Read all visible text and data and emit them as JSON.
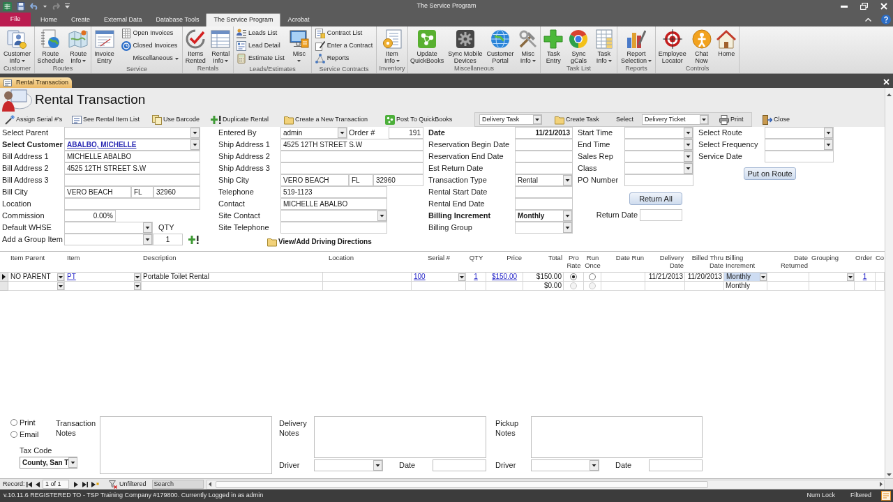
{
  "window": {
    "title": "The Service Program"
  },
  "ribbon_tabs": [
    {
      "label": "File",
      "kind": "file",
      "selected": false
    },
    {
      "label": "Home",
      "kind": "tab",
      "selected": false
    },
    {
      "label": "Create",
      "kind": "tab",
      "selected": false
    },
    {
      "label": "External Data",
      "kind": "tab",
      "selected": false
    },
    {
      "label": "Database Tools",
      "kind": "tab",
      "selected": false
    },
    {
      "label": "The Service Program",
      "kind": "tab",
      "selected": true
    },
    {
      "label": "Acrobat",
      "kind": "tab",
      "selected": false
    }
  ],
  "ribbon_groups": [
    {
      "label": "Customer",
      "items": [
        {
          "kind": "large",
          "label": [
            "Customer",
            "Info"
          ],
          "dropdown": true
        }
      ]
    },
    {
      "label": "Routes",
      "items": [
        {
          "kind": "large",
          "label": [
            "Route",
            "Schedule"
          ],
          "dropdown": false
        },
        {
          "kind": "large",
          "label": [
            "Route",
            "Info"
          ],
          "dropdown": true
        }
      ]
    },
    {
      "label": "Service",
      "items": [
        {
          "kind": "large",
          "label": [
            "Invoice",
            "Entry"
          ],
          "dropdown": false
        },
        {
          "kind": "small",
          "label": "Open Invoices",
          "dropdown": false
        },
        {
          "kind": "small",
          "label": "Closed Invoices",
          "dropdown": false
        },
        {
          "kind": "small",
          "label": "Miscellaneous",
          "dropdown": true
        }
      ]
    },
    {
      "label": "Rentals",
      "items": [
        {
          "kind": "large",
          "label": [
            "Items",
            "Rented"
          ],
          "dropdown": false
        },
        {
          "kind": "large",
          "label": [
            "Rental",
            "Info"
          ],
          "dropdown": true
        }
      ]
    },
    {
      "label": "Leads/Estimates",
      "items": [
        {
          "kind": "small",
          "label": "Leads List",
          "dropdown": false
        },
        {
          "kind": "small",
          "label": "Lead Detail",
          "dropdown": false
        },
        {
          "kind": "small",
          "label": "Estimate List",
          "dropdown": false
        },
        {
          "kind": "large",
          "label": [
            "Misc"
          ],
          "dropdown": true
        }
      ]
    },
    {
      "label": "Service Contracts",
      "items": [
        {
          "kind": "small",
          "label": "Contract List",
          "dropdown": false
        },
        {
          "kind": "small",
          "label": "Enter a Contract",
          "dropdown": false
        },
        {
          "kind": "small",
          "label": "Reports",
          "dropdown": false
        }
      ]
    },
    {
      "label": "Inventory",
      "items": [
        {
          "kind": "large",
          "label": [
            "Item",
            "Info"
          ],
          "dropdown": true
        }
      ]
    },
    {
      "label": "Miscellaneous",
      "items": [
        {
          "kind": "large",
          "label": [
            "Update",
            "QuickBooks"
          ],
          "dropdown": false
        },
        {
          "kind": "large",
          "label": [
            "Sync Mobile",
            "Devices"
          ],
          "dropdown": false
        },
        {
          "kind": "large",
          "label": [
            "Customer",
            "Portal"
          ],
          "dropdown": false
        },
        {
          "kind": "large",
          "label": [
            "Misc",
            "Info"
          ],
          "dropdown": true
        }
      ]
    },
    {
      "label": "Task List",
      "items": [
        {
          "kind": "large",
          "label": [
            "Task",
            "Entry"
          ],
          "dropdown": false
        },
        {
          "kind": "large",
          "label": [
            "Sync",
            "gCals"
          ],
          "dropdown": false
        },
        {
          "kind": "large",
          "label": [
            "Task",
            "Info"
          ],
          "dropdown": true
        }
      ]
    },
    {
      "label": "Reports",
      "items": [
        {
          "kind": "large",
          "label": [
            "Report",
            "Selection"
          ],
          "dropdown": true
        }
      ]
    },
    {
      "label": "Controls",
      "items": [
        {
          "kind": "large",
          "label": [
            "Employee",
            "Locator"
          ],
          "dropdown": false
        },
        {
          "kind": "large",
          "label": [
            "Chat",
            "Now"
          ],
          "dropdown": false
        },
        {
          "kind": "large",
          "label": [
            "Home"
          ],
          "dropdown": false
        }
      ]
    }
  ],
  "document_tabs": [
    {
      "label": "Rental Transaction",
      "selected": true
    }
  ],
  "form": {
    "title": "Rental Transaction",
    "toolbar": [
      {
        "label": "Assign Serial #'s"
      },
      {
        "label": "See Rental Item List"
      },
      {
        "label": "Use Barcode"
      },
      {
        "label": "Duplicate Rental"
      },
      {
        "label": "Create a New Transaction"
      },
      {
        "label": "Post To QuickBooks"
      }
    ],
    "task_box": [
      {
        "kind": "combo",
        "value": "Delivery Task"
      },
      {
        "kind": "link",
        "label": "Create Task"
      },
      {
        "kind": "caption",
        "label": "Select"
      },
      {
        "kind": "combo",
        "value": "Delivery Ticket"
      },
      {
        "kind": "link",
        "label": "Print"
      }
    ],
    "close_link": {
      "label": "Close"
    },
    "columns": [
      {
        "rows": [
          {
            "kind": "field",
            "label": "Select Parent",
            "emphasized": false,
            "fields": [
              {
                "kind": "combo"
              }
            ]
          },
          {
            "kind": "field",
            "label": "Select Customer",
            "emphasized": true,
            "fields": [
              {
                "kind": "link-combo",
                "value": "ABALBO, MICHELLE"
              }
            ]
          },
          {
            "kind": "field",
            "label": "Bill Address 1",
            "emphasized": false,
            "fields": [
              {
                "kind": "text",
                "value": "MICHELLE ABALBO"
              }
            ]
          },
          {
            "kind": "field",
            "label": "Bill Address 2",
            "emphasized": false,
            "fields": [
              {
                "kind": "text",
                "value": "4525 12TH STREET S.W"
              }
            ]
          },
          {
            "kind": "field",
            "label": "Bill Address 3",
            "emphasized": false,
            "fields": [
              {
                "kind": "text"
              }
            ]
          },
          {
            "kind": "field",
            "label": "Bill City",
            "emphasized": false,
            "fields": [
              {
                "kind": "text",
                "value": "VERO BEACH"
              },
              {
                "kind": "text",
                "value": "FL"
              },
              {
                "kind": "text",
                "value": "32960"
              }
            ]
          },
          {
            "kind": "field",
            "label": "Location",
            "emphasized": false,
            "fields": [
              {
                "kind": "text"
              }
            ]
          },
          {
            "kind": "field",
            "label": "Commission",
            "emphasized": false,
            "fields": [
              {
                "kind": "number",
                "value": "0.00%"
              }
            ]
          },
          {
            "kind": "field",
            "label": "Default WHSE",
            "emphasized": false,
            "fields": [
              {
                "kind": "combo"
              },
              {
                "kind": "caption",
                "label": "QTY"
              }
            ]
          },
          {
            "kind": "field",
            "label": "Add a Group Item",
            "emphasized": false,
            "fields": [
              {
                "kind": "combo"
              },
              {
                "kind": "qty",
                "value": "1"
              },
              {
                "kind": "add-button"
              }
            ]
          }
        ]
      },
      {
        "rows": [
          {
            "kind": "field",
            "label": "Entered By",
            "emphasized": false,
            "fields": [
              {
                "kind": "combo",
                "value": "admin"
              },
              {
                "kind": "caption",
                "label": "Order #"
              },
              {
                "kind": "number",
                "value": "191"
              }
            ]
          },
          {
            "kind": "field",
            "label": "Ship Address 1",
            "emphasized": false,
            "fields": [
              {
                "kind": "text",
                "value": "4525 12TH STREET S.W"
              }
            ]
          },
          {
            "kind": "field",
            "label": "Ship Address 2",
            "emphasized": false,
            "fields": [
              {
                "kind": "text"
              }
            ]
          },
          {
            "kind": "field",
            "label": "Ship Address 3",
            "emphasized": false,
            "fields": [
              {
                "kind": "text"
              }
            ]
          },
          {
            "kind": "field",
            "label": "Ship City",
            "emphasized": false,
            "fields": [
              {
                "kind": "text",
                "value": "VERO BEACH"
              },
              {
                "kind": "text",
                "value": "FL"
              },
              {
                "kind": "text",
                "value": "32960"
              }
            ]
          },
          {
            "kind": "field",
            "label": "Telephone",
            "emphasized": false,
            "fields": [
              {
                "kind": "text",
                "value": "519-1123"
              }
            ]
          },
          {
            "kind": "field",
            "label": "Contact",
            "emphasized": false,
            "fields": [
              {
                "kind": "text",
                "value": "MICHELLE ABALBO"
              }
            ]
          },
          {
            "kind": "field",
            "label": "Site Contact",
            "emphasized": false,
            "fields": [
              {
                "kind": "combo"
              }
            ]
          },
          {
            "kind": "field",
            "label": "Site Telephone",
            "emphasized": false,
            "fields": [
              {
                "kind": "text"
              }
            ]
          },
          {
            "kind": "link",
            "label": "View/Add Driving Directions"
          }
        ]
      },
      {
        "rows": [
          {
            "kind": "field",
            "label": "Date",
            "emphasized": true,
            "fields": [
              {
                "kind": "date",
                "value": "11/21/2013"
              }
            ]
          },
          {
            "kind": "field",
            "label": "Reservation Begin Date",
            "emphasized": false,
            "fields": [
              {
                "kind": "date"
              }
            ]
          },
          {
            "kind": "field",
            "label": "Reservation End Date",
            "emphasized": false,
            "fields": [
              {
                "kind": "date"
              }
            ]
          },
          {
            "kind": "field",
            "label": "Est Return Date",
            "emphasized": false,
            "fields": [
              {
                "kind": "date"
              }
            ]
          },
          {
            "kind": "field",
            "label": "Transaction Type",
            "emphasized": false,
            "fields": [
              {
                "kind": "combo",
                "value": "Rental"
              }
            ]
          },
          {
            "kind": "field",
            "label": "Rental Start Date",
            "emphasized": false,
            "fields": [
              {
                "kind": "date"
              }
            ]
          },
          {
            "kind": "field",
            "label": "Rental End Date",
            "emphasized": false,
            "fields": [
              {
                "kind": "date"
              }
            ]
          },
          {
            "kind": "field",
            "label": "Billing Increment",
            "emphasized": true,
            "fields": [
              {
                "kind": "combo",
                "value": "Monthly"
              }
            ]
          },
          {
            "kind": "field",
            "label": "Billing Group",
            "emphasized": false,
            "fields": [
              {
                "kind": "combo"
              }
            ]
          }
        ]
      },
      {
        "rows": [
          {
            "kind": "field",
            "label": "Start Time",
            "emphasized": false,
            "fields": [
              {
                "kind": "combo"
              }
            ]
          },
          {
            "kind": "field",
            "label": "End Time",
            "emphasized": false,
            "fields": [
              {
                "kind": "combo"
              }
            ]
          },
          {
            "kind": "field",
            "label": "Sales Rep",
            "emphasized": false,
            "fields": [
              {
                "kind": "combo"
              }
            ]
          },
          {
            "kind": "field",
            "label": "Class",
            "emphasized": false,
            "fields": [
              {
                "kind": "combo"
              }
            ]
          },
          {
            "kind": "field",
            "label": "PO Number",
            "emphasized": false,
            "fields": [
              {
                "kind": "text"
              }
            ]
          },
          {
            "kind": "button",
            "label": "Return All"
          },
          {
            "kind": "field",
            "label": "Return Date",
            "emphasized": false,
            "fields": [
              {
                "kind": "date"
              }
            ]
          }
        ]
      },
      {
        "rows": [
          {
            "kind": "field",
            "label": "Select Route",
            "emphasized": false,
            "fields": [
              {
                "kind": "combo"
              }
            ]
          },
          {
            "kind": "field",
            "label": "Select Frequency",
            "emphasized": false,
            "fields": [
              {
                "kind": "combo"
              }
            ]
          },
          {
            "kind": "field",
            "label": "Service Date",
            "emphasized": false,
            "fields": [
              {
                "kind": "date"
              }
            ]
          },
          {
            "kind": "button",
            "label": "Put on Route"
          }
        ]
      }
    ]
  },
  "datasheet": {
    "columns": [
      {
        "label": "Item Parent"
      },
      {
        "label": "Item"
      },
      {
        "label": "Description"
      },
      {
        "label": "Location"
      },
      {
        "label": "Serial #"
      },
      {
        "label": "QTY"
      },
      {
        "label": "Price"
      },
      {
        "label": "Total"
      },
      {
        "label": "Pro Rate"
      },
      {
        "label": "Run Once"
      },
      {
        "label": "Date Run"
      },
      {
        "label": "Delivery Date"
      },
      {
        "label": "Billed Thru Date"
      },
      {
        "label": "Billing Increment"
      },
      {
        "label": "Date Returned"
      },
      {
        "label": "Grouping"
      },
      {
        "label": "Order"
      },
      {
        "label": "Co"
      }
    ],
    "rows": [
      {
        "current": true,
        "cells": [
          {
            "kind": "combo",
            "value": "NO PARENT",
            "focused": false
          },
          {
            "kind": "link-combo",
            "value": "PT",
            "focused": false
          },
          {
            "kind": "text",
            "value": "Portable Toilet Rental",
            "focused": false
          },
          {
            "kind": "text",
            "focused": false
          },
          {
            "kind": "link-combo",
            "value": "100",
            "focused": false
          },
          {
            "kind": "link",
            "value": "1",
            "focused": false
          },
          {
            "kind": "link",
            "value": "$150.00",
            "focused": false
          },
          {
            "kind": "money",
            "value": "$150.00",
            "focused": false
          },
          {
            "kind": "radio",
            "checked": true,
            "disabled": false,
            "focused": false
          },
          {
            "kind": "radio",
            "checked": false,
            "disabled": false,
            "focused": false
          },
          {
            "kind": "text",
            "focused": false
          },
          {
            "kind": "date",
            "value": "11/21/2013",
            "focused": false
          },
          {
            "kind": "date",
            "value": "11/20/2013",
            "focused": false
          },
          {
            "kind": "combo",
            "value": "Monthly",
            "focused": true
          },
          {
            "kind": "text",
            "focused": false
          },
          {
            "kind": "combo",
            "focused": false
          },
          {
            "kind": "link",
            "value": "1",
            "focused": false
          },
          {
            "kind": "text",
            "focused": false
          }
        ]
      },
      {
        "current": false,
        "cells": [
          {
            "kind": "combo",
            "focused": false
          },
          {
            "kind": "combo",
            "focused": false
          },
          {
            "kind": "text",
            "focused": false
          },
          {
            "kind": "text",
            "focused": false
          },
          {
            "kind": "text",
            "focused": false
          },
          {
            "kind": "text",
            "focused": false
          },
          {
            "kind": "text",
            "focused": false
          },
          {
            "kind": "money",
            "value": "$0.00",
            "focused": false
          },
          {
            "kind": "radio",
            "checked": false,
            "disabled": true,
            "focused": false
          },
          {
            "kind": "radio",
            "checked": false,
            "disabled": true,
            "focused": false
          },
          {
            "kind": "text",
            "focused": false
          },
          {
            "kind": "date",
            "focused": false
          },
          {
            "kind": "date",
            "focused": false
          },
          {
            "kind": "text",
            "value": "Monthly",
            "focused": false
          },
          {
            "kind": "text",
            "focused": false
          },
          {
            "kind": "text",
            "focused": false
          },
          {
            "kind": "text",
            "focused": false
          },
          {
            "kind": "text",
            "focused": false
          }
        ]
      }
    ]
  },
  "notes_section": {
    "output_options": [
      {
        "label": "Print",
        "selected": false
      },
      {
        "label": "Email",
        "selected": false
      }
    ],
    "transaction_notes": {
      "label": "Transaction Notes"
    },
    "tax_code": {
      "label": "Tax Code",
      "value": "County, San T"
    },
    "dispatch_notes": [
      {
        "label": "Delivery Notes",
        "driver_label": "Driver",
        "date_label": "Date"
      },
      {
        "label": "Pickup Notes",
        "driver_label": "Driver",
        "date_label": "Date"
      }
    ]
  },
  "record_nav": {
    "label": "Record:",
    "position": "1 of 1",
    "filter": "Unfiltered",
    "search": {
      "placeholder": "Search"
    }
  },
  "status_bar": {
    "text": "v.10.11.6 REGISTERED TO - TSP Training Company #179800. Currently Logged in as admin",
    "indicators": [
      "Num Lock",
      "Filtered"
    ]
  }
}
